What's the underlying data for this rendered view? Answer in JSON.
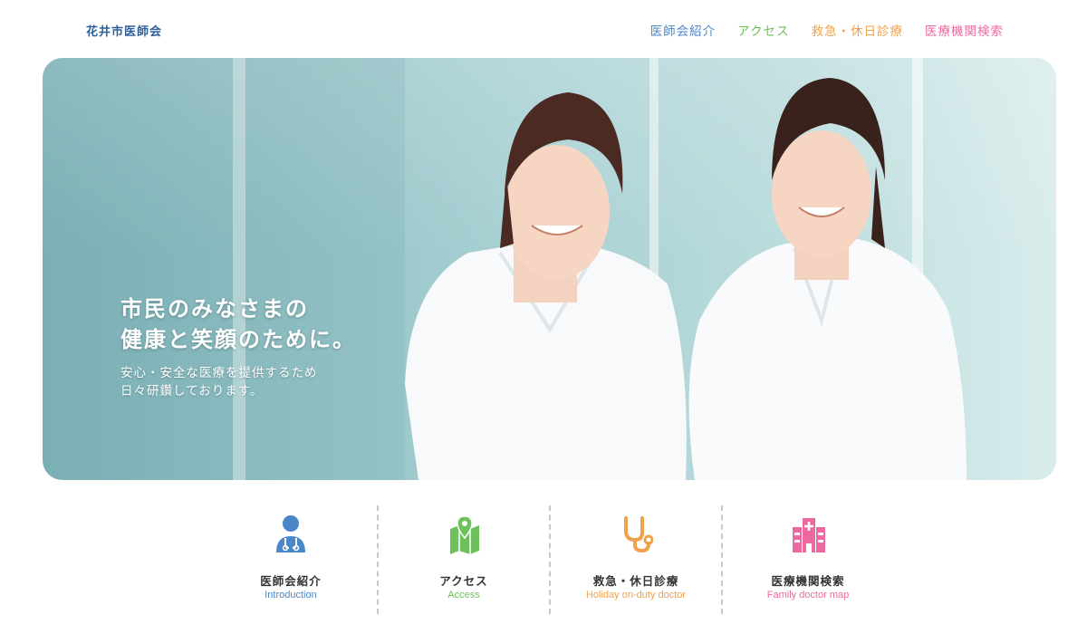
{
  "header": {
    "logo": "花井市医師会",
    "nav": [
      {
        "label": "医師会紹介",
        "color": "#4a87c8"
      },
      {
        "label": "アクセス",
        "color": "#6ec15a"
      },
      {
        "label": "救急・休日診療",
        "color": "#f0a24a"
      },
      {
        "label": "医療機関検索",
        "color": "#ea6aa0"
      }
    ]
  },
  "hero": {
    "title_line1": "市民のみなさまの",
    "title_line2": "健康と笑顔のために。",
    "sub_line1": "安心・安全な医療を提供するため",
    "sub_line2": "日々研鑽しております。"
  },
  "quick_menu": [
    {
      "label": "医師会紹介",
      "sub": "Introduction",
      "color": "#4a87c8",
      "icon": "doctor-icon"
    },
    {
      "label": "アクセス",
      "sub": "Access",
      "color": "#6ec15a",
      "icon": "map-pin-icon"
    },
    {
      "label": "救急・休日診療",
      "sub": "Holiday on-duty doctor",
      "color": "#f0a24a",
      "icon": "stethoscope-icon"
    },
    {
      "label": "医療機関検索",
      "sub": "Family doctor map",
      "color": "#ea6aa0",
      "icon": "hospital-icon"
    }
  ]
}
